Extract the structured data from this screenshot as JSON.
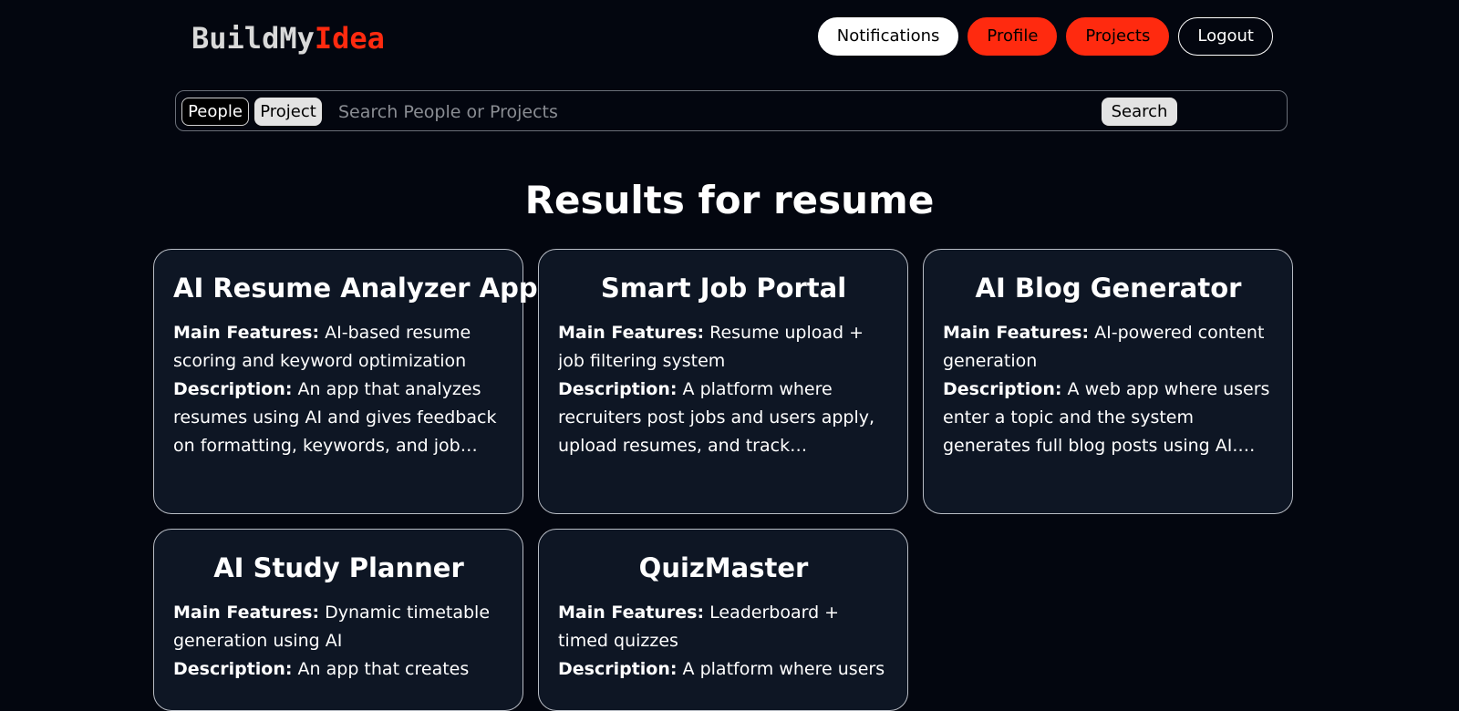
{
  "header": {
    "logo_part1": "BuildMy",
    "logo_part2": "Idea",
    "nav": {
      "notifications": "Notifications",
      "profile": "Profile",
      "projects": "Projects",
      "logout": "Logout"
    }
  },
  "search": {
    "toggle_people": "People",
    "toggle_project": "Project",
    "placeholder": "Search People or Projects",
    "value": "",
    "button": "Search"
  },
  "results": {
    "title": "Results for resume",
    "features_label": "Main Features:",
    "description_label": "Description:",
    "items": [
      {
        "title": "AI Resume Analyzer App",
        "features": "AI-based resume scoring and keyword optimization",
        "description": "An app that analyzes resumes using AI and gives feedback on formatting, keywords, and job matching. Users upload their resume..."
      },
      {
        "title": "Smart Job Portal",
        "features": "Resume upload + job filtering system",
        "description": "A platform where recruiters post jobs and users apply, upload resumes, and track applications."
      },
      {
        "title": "AI Blog Generator",
        "features": "AI-powered content generation",
        "description": "A web app where users enter a topic and the system generates full blog posts using AI. Includes editing, saving, and exporting content."
      },
      {
        "title": "AI Study Planner",
        "features": "Dynamic timetable generation using AI",
        "description": "An app that creates"
      },
      {
        "title": "QuizMaster",
        "features": "Leaderboard + timed quizzes",
        "description": "A platform where users"
      }
    ]
  }
}
